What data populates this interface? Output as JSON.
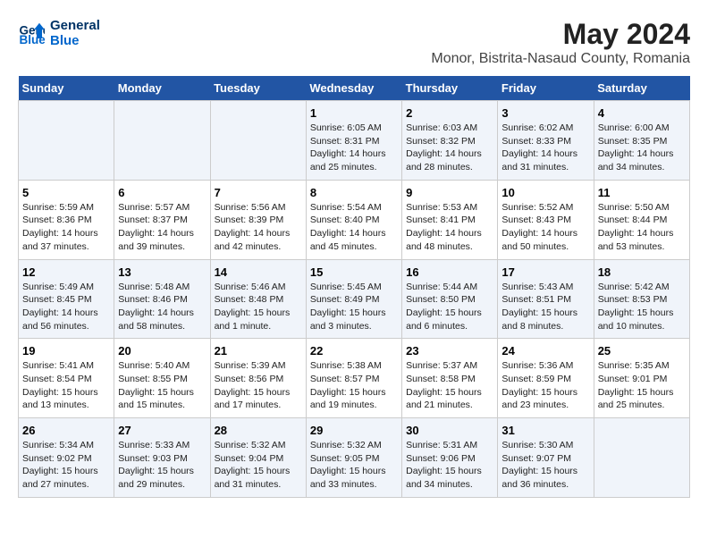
{
  "logo": {
    "line1": "General",
    "line2": "Blue"
  },
  "title": "May 2024",
  "subtitle": "Monor, Bistrita-Nasaud County, Romania",
  "headers": [
    "Sunday",
    "Monday",
    "Tuesday",
    "Wednesday",
    "Thursday",
    "Friday",
    "Saturday"
  ],
  "weeks": [
    [
      {
        "day": "",
        "content": ""
      },
      {
        "day": "",
        "content": ""
      },
      {
        "day": "",
        "content": ""
      },
      {
        "day": "1",
        "content": "Sunrise: 6:05 AM\nSunset: 8:31 PM\nDaylight: 14 hours\nand 25 minutes."
      },
      {
        "day": "2",
        "content": "Sunrise: 6:03 AM\nSunset: 8:32 PM\nDaylight: 14 hours\nand 28 minutes."
      },
      {
        "day": "3",
        "content": "Sunrise: 6:02 AM\nSunset: 8:33 PM\nDaylight: 14 hours\nand 31 minutes."
      },
      {
        "day": "4",
        "content": "Sunrise: 6:00 AM\nSunset: 8:35 PM\nDaylight: 14 hours\nand 34 minutes."
      }
    ],
    [
      {
        "day": "5",
        "content": "Sunrise: 5:59 AM\nSunset: 8:36 PM\nDaylight: 14 hours\nand 37 minutes."
      },
      {
        "day": "6",
        "content": "Sunrise: 5:57 AM\nSunset: 8:37 PM\nDaylight: 14 hours\nand 39 minutes."
      },
      {
        "day": "7",
        "content": "Sunrise: 5:56 AM\nSunset: 8:39 PM\nDaylight: 14 hours\nand 42 minutes."
      },
      {
        "day": "8",
        "content": "Sunrise: 5:54 AM\nSunset: 8:40 PM\nDaylight: 14 hours\nand 45 minutes."
      },
      {
        "day": "9",
        "content": "Sunrise: 5:53 AM\nSunset: 8:41 PM\nDaylight: 14 hours\nand 48 minutes."
      },
      {
        "day": "10",
        "content": "Sunrise: 5:52 AM\nSunset: 8:43 PM\nDaylight: 14 hours\nand 50 minutes."
      },
      {
        "day": "11",
        "content": "Sunrise: 5:50 AM\nSunset: 8:44 PM\nDaylight: 14 hours\nand 53 minutes."
      }
    ],
    [
      {
        "day": "12",
        "content": "Sunrise: 5:49 AM\nSunset: 8:45 PM\nDaylight: 14 hours\nand 56 minutes."
      },
      {
        "day": "13",
        "content": "Sunrise: 5:48 AM\nSunset: 8:46 PM\nDaylight: 14 hours\nand 58 minutes."
      },
      {
        "day": "14",
        "content": "Sunrise: 5:46 AM\nSunset: 8:48 PM\nDaylight: 15 hours\nand 1 minute."
      },
      {
        "day": "15",
        "content": "Sunrise: 5:45 AM\nSunset: 8:49 PM\nDaylight: 15 hours\nand 3 minutes."
      },
      {
        "day": "16",
        "content": "Sunrise: 5:44 AM\nSunset: 8:50 PM\nDaylight: 15 hours\nand 6 minutes."
      },
      {
        "day": "17",
        "content": "Sunrise: 5:43 AM\nSunset: 8:51 PM\nDaylight: 15 hours\nand 8 minutes."
      },
      {
        "day": "18",
        "content": "Sunrise: 5:42 AM\nSunset: 8:53 PM\nDaylight: 15 hours\nand 10 minutes."
      }
    ],
    [
      {
        "day": "19",
        "content": "Sunrise: 5:41 AM\nSunset: 8:54 PM\nDaylight: 15 hours\nand 13 minutes."
      },
      {
        "day": "20",
        "content": "Sunrise: 5:40 AM\nSunset: 8:55 PM\nDaylight: 15 hours\nand 15 minutes."
      },
      {
        "day": "21",
        "content": "Sunrise: 5:39 AM\nSunset: 8:56 PM\nDaylight: 15 hours\nand 17 minutes."
      },
      {
        "day": "22",
        "content": "Sunrise: 5:38 AM\nSunset: 8:57 PM\nDaylight: 15 hours\nand 19 minutes."
      },
      {
        "day": "23",
        "content": "Sunrise: 5:37 AM\nSunset: 8:58 PM\nDaylight: 15 hours\nand 21 minutes."
      },
      {
        "day": "24",
        "content": "Sunrise: 5:36 AM\nSunset: 8:59 PM\nDaylight: 15 hours\nand 23 minutes."
      },
      {
        "day": "25",
        "content": "Sunrise: 5:35 AM\nSunset: 9:01 PM\nDaylight: 15 hours\nand 25 minutes."
      }
    ],
    [
      {
        "day": "26",
        "content": "Sunrise: 5:34 AM\nSunset: 9:02 PM\nDaylight: 15 hours\nand 27 minutes."
      },
      {
        "day": "27",
        "content": "Sunrise: 5:33 AM\nSunset: 9:03 PM\nDaylight: 15 hours\nand 29 minutes."
      },
      {
        "day": "28",
        "content": "Sunrise: 5:32 AM\nSunset: 9:04 PM\nDaylight: 15 hours\nand 31 minutes."
      },
      {
        "day": "29",
        "content": "Sunrise: 5:32 AM\nSunset: 9:05 PM\nDaylight: 15 hours\nand 33 minutes."
      },
      {
        "day": "30",
        "content": "Sunrise: 5:31 AM\nSunset: 9:06 PM\nDaylight: 15 hours\nand 34 minutes."
      },
      {
        "day": "31",
        "content": "Sunrise: 5:30 AM\nSunset: 9:07 PM\nDaylight: 15 hours\nand 36 minutes."
      },
      {
        "day": "",
        "content": ""
      }
    ]
  ]
}
